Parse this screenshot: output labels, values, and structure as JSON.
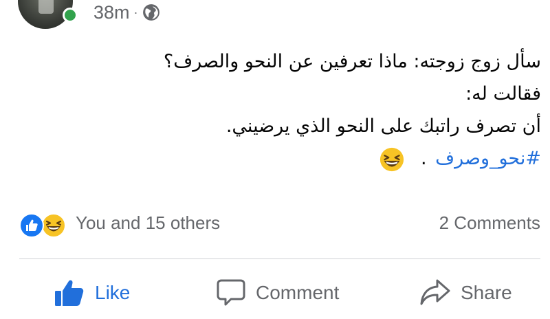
{
  "post": {
    "time": "38m",
    "separator": "·",
    "privacy_icon": "globe-icon",
    "text_lines": [
      "سأل زوج زوجته: ماذا تعرفين عن النحو والصرف؟",
      "فقالت له:",
      "أن تصرف راتبك على النحو الذي يرضيني."
    ],
    "hashtag": "#نحو_وصرف",
    "hashtag_suffix": ".",
    "emoji": "grinning-squinting-face-emoji"
  },
  "reactions": {
    "icons": [
      "like-reaction-icon",
      "haha-reaction-icon"
    ],
    "summary": "You and 15 others",
    "comments": "2 Comments"
  },
  "actions": {
    "like": "Like",
    "comment": "Comment",
    "share": "Share"
  },
  "colors": {
    "accent": "#216fdb",
    "secondary_text": "#65676b",
    "online": "#31a24c",
    "divider": "#ced0d4"
  }
}
